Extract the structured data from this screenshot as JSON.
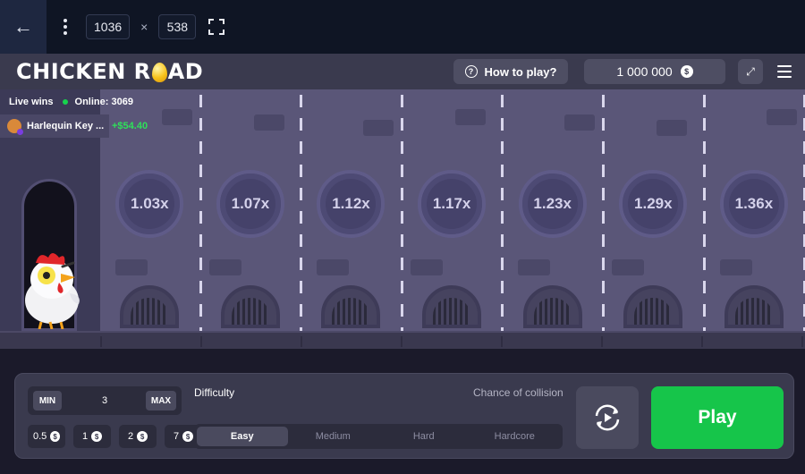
{
  "devbar": {
    "width_value": "1036",
    "times": "×",
    "height_value": "538"
  },
  "game": {
    "logo_left": "CHICKEN R",
    "logo_right": "AD",
    "how_to_play": "How to play?",
    "balance": "1 000 000",
    "currency_symbol": "$"
  },
  "live": {
    "label": "Live wins",
    "online": "Online: 3069",
    "player": "Harlequin Key ...",
    "amount": "+$54.40"
  },
  "multipliers": [
    "1.03x",
    "1.07x",
    "1.12x",
    "1.17x",
    "1.23x",
    "1.29x",
    "1.36x"
  ],
  "bet": {
    "min_label": "MIN",
    "max_label": "MAX",
    "value": "3",
    "chips": [
      "0.5",
      "1",
      "2",
      "7"
    ]
  },
  "difficulty": {
    "label": "Difficulty",
    "chance_label": "Chance of collision",
    "options": [
      "Easy",
      "Medium",
      "Hard",
      "Hardcore"
    ],
    "selected": "Easy"
  },
  "play_label": "Play",
  "colors": {
    "play": "#16c54a",
    "online_dot": "#17d34d",
    "win_amount": "#2fe05a",
    "egg": "#f7c21a"
  }
}
